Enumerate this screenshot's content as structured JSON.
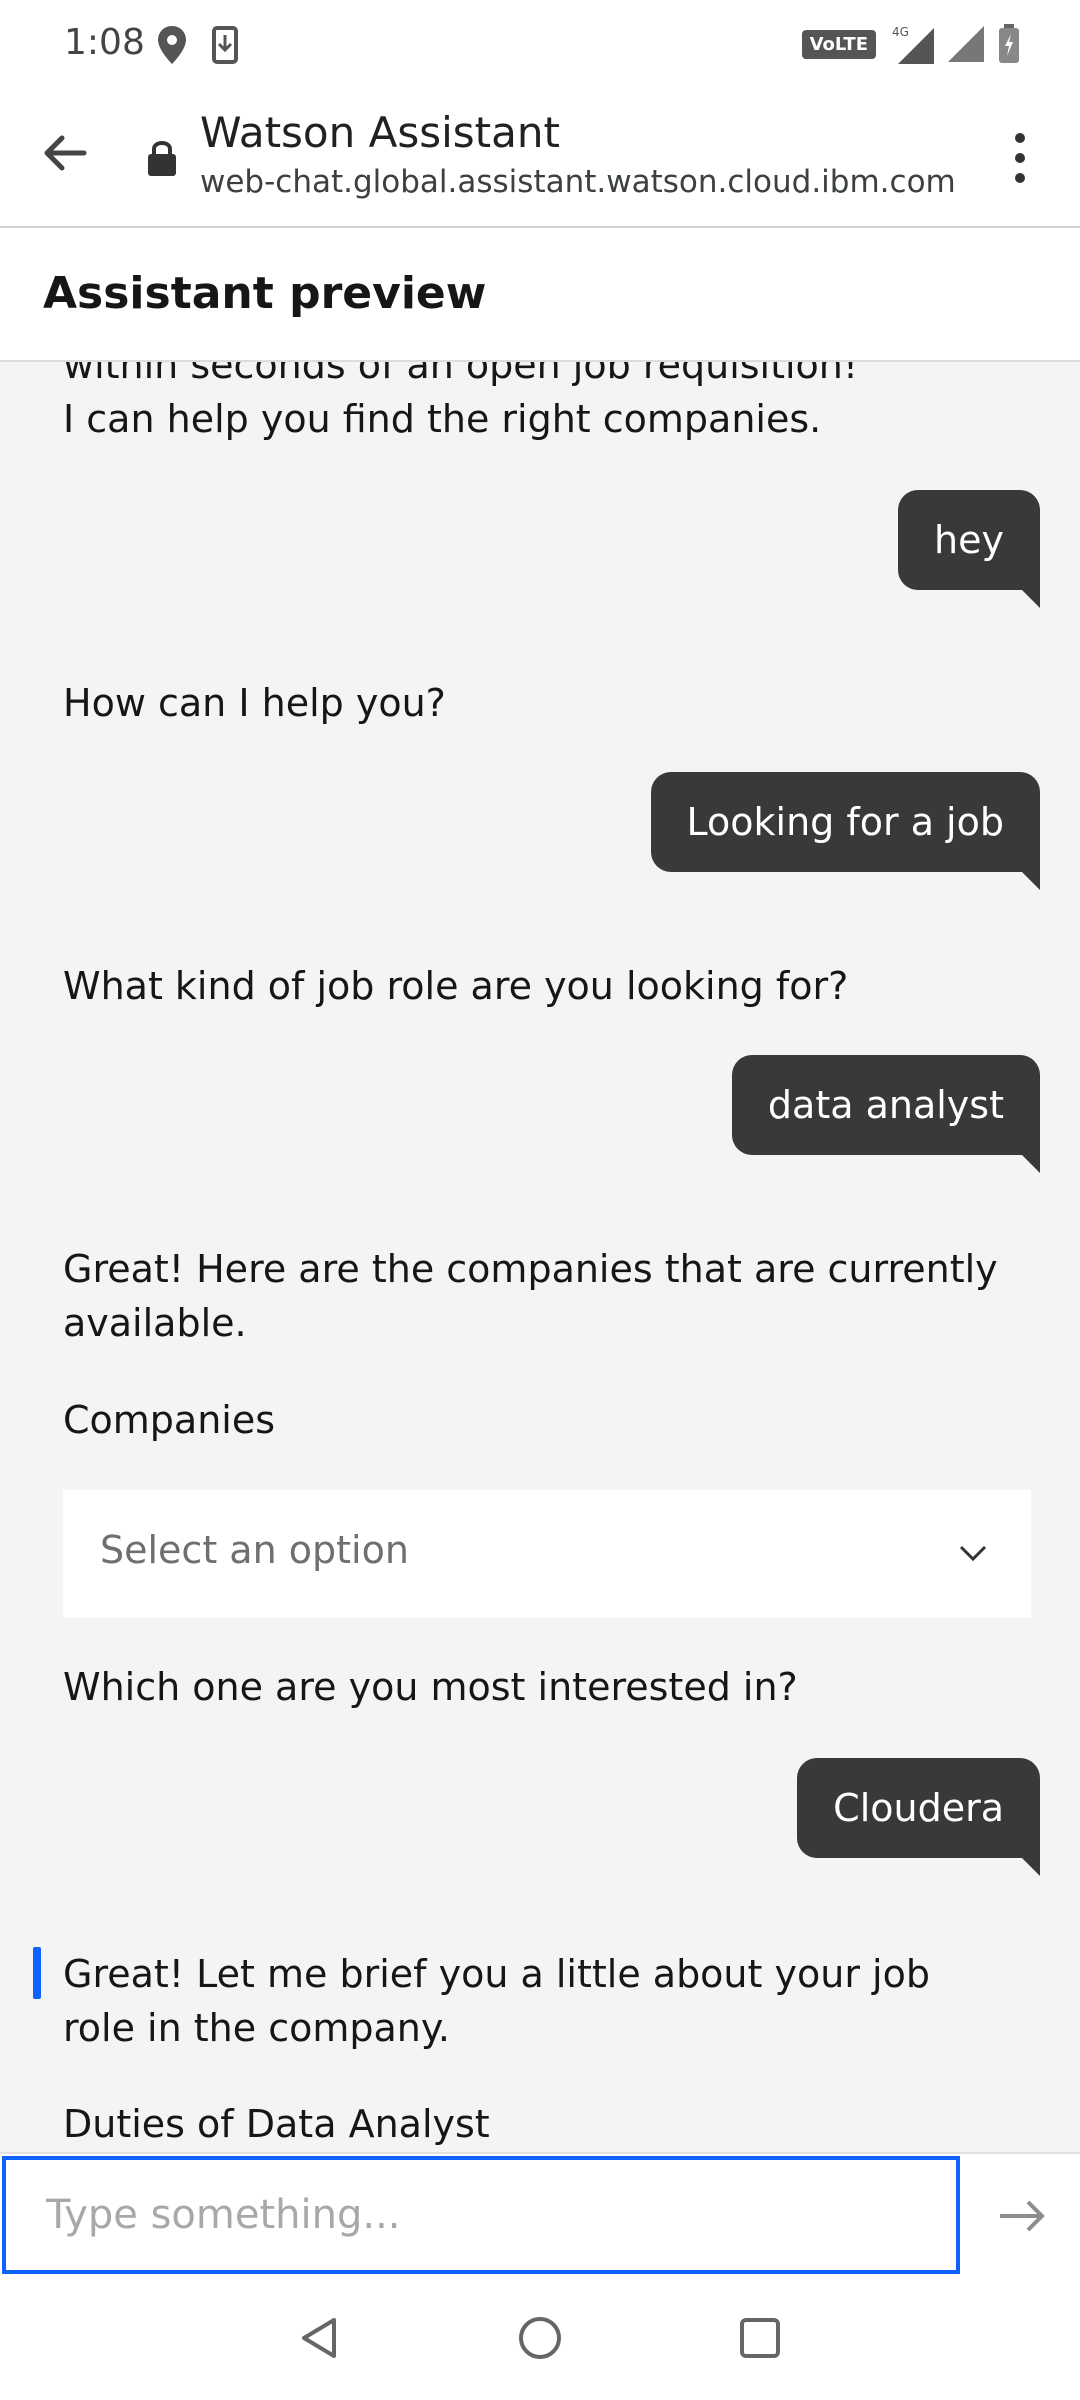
{
  "status_bar": {
    "time": "1:08",
    "volte_label": "VoLTE",
    "network_label": "4G"
  },
  "browser": {
    "title": "Watson Assistant",
    "url": "web-chat.global.assistant.watson.cloud.ibm.com"
  },
  "header": {
    "title": "Assistant preview"
  },
  "chat": {
    "messages": [
      {
        "from": "bot",
        "text": "within seconds of an open job requisition!"
      },
      {
        "from": "bot",
        "text": "I can help you find the right companies."
      },
      {
        "from": "user",
        "text": "hey"
      },
      {
        "from": "bot",
        "text": "How can I help you?"
      },
      {
        "from": "user",
        "text": "Looking for a job"
      },
      {
        "from": "bot",
        "text": "What kind of job role are you looking for?"
      },
      {
        "from": "user",
        "text": "data analyst"
      },
      {
        "from": "bot",
        "text": "Great! Here are the companies that are currently available."
      },
      {
        "from": "bot",
        "text": "Companies"
      },
      {
        "from": "bot",
        "text": "Which one are you most interested in?"
      },
      {
        "from": "user",
        "text": "Cloudera"
      },
      {
        "from": "bot",
        "text": "Great! Let me brief you a little about your job role in the company."
      },
      {
        "from": "bot",
        "text": "Duties of Data Analyst"
      }
    ],
    "select": {
      "placeholder": "Select an option"
    }
  },
  "input": {
    "placeholder": "Type something..."
  },
  "colors": {
    "accent": "#0f62fe",
    "user_bubble": "#393939",
    "chat_background": "#f4f4f4"
  },
  "icons": {
    "back": "arrow-left-icon",
    "lock": "lock-icon",
    "menu": "kebab-menu-icon",
    "chevron": "chevron-down-icon",
    "send": "arrow-right-icon",
    "nav_back": "triangle-back-icon",
    "nav_home": "circle-home-icon",
    "nav_recents": "square-recents-icon"
  }
}
